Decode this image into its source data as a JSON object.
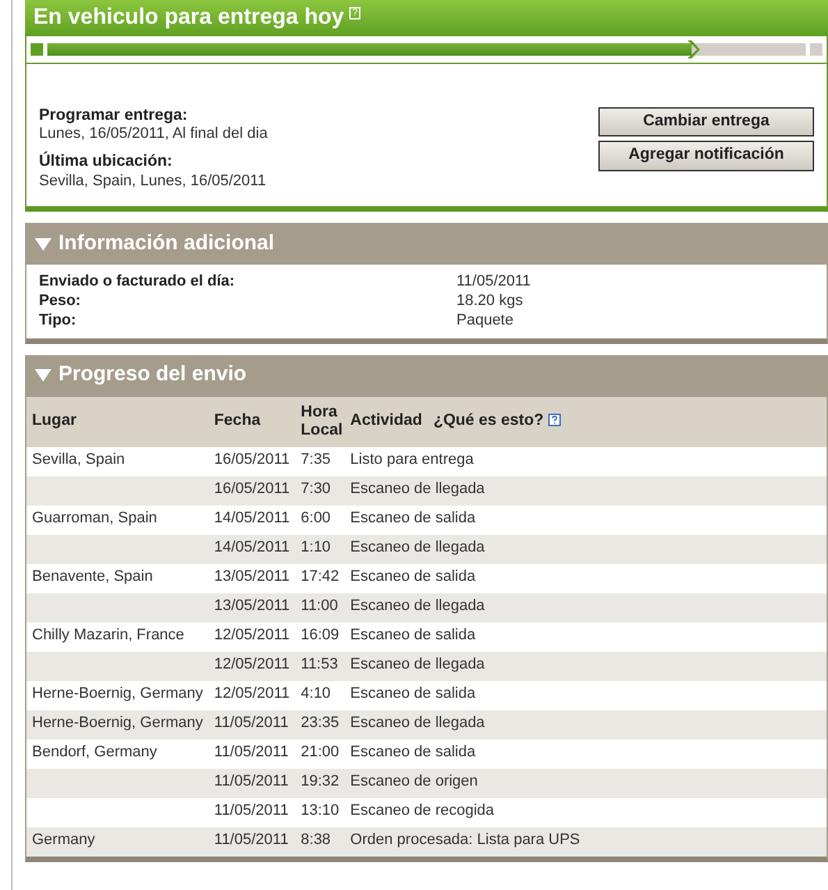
{
  "status": {
    "title": "En vehiculo para entrega hoy",
    "help_icon": "?",
    "progress": {
      "level": 0.85
    }
  },
  "delivery": {
    "fields": [
      {
        "label": "Programar entrega:",
        "value": "Lunes, 16/05/2011, Al final del dia"
      },
      {
        "label": "Última ubicación:",
        "value": "Sevilla, Spain, Lunes, 16/05/2011"
      }
    ],
    "buttons": [
      "Cambiar entrega",
      "Agregar notificación"
    ]
  },
  "additional_info": {
    "title": "Información adicional",
    "expanded": true,
    "rows": [
      {
        "label": "Enviado o facturado el día:",
        "value": "11/05/2011"
      },
      {
        "label": "Peso:",
        "value": "18.20 kgs"
      },
      {
        "label": "Tipo:",
        "value": "Paquete"
      }
    ]
  },
  "progress_table": {
    "title": "Progreso del envio",
    "expanded": true,
    "columns": [
      "Lugar",
      "Fecha",
      "Hora Local",
      "Actividad"
    ],
    "help_link": "¿Qué es esto?",
    "rows": [
      {
        "place": "Sevilla, Spain",
        "date": "16/05/2011",
        "time": "7:35",
        "activity": "Listo para entrega"
      },
      {
        "date": "16/05/2011",
        "time": "7:30",
        "activity": "Escaneo de llegada"
      },
      {
        "place": "Guarroman, Spain",
        "date": "14/05/2011",
        "time": "6:00",
        "activity": "Escaneo de salida"
      },
      {
        "date": "14/05/2011",
        "time": "1:10",
        "activity": "Escaneo de llegada"
      },
      {
        "place": "Benavente, Spain",
        "date": "13/05/2011",
        "time": "17:42",
        "activity": "Escaneo de salida"
      },
      {
        "date": "13/05/2011",
        "time": "11:00",
        "activity": "Escaneo de llegada"
      },
      {
        "place": "Chilly Mazarin, France",
        "date": "12/05/2011",
        "time": "16:09",
        "activity": "Escaneo de salida"
      },
      {
        "date": "12/05/2011",
        "time": "11:53",
        "activity": "Escaneo de llegada"
      },
      {
        "place": "Herne-Boernig, Germany",
        "date": "12/05/2011",
        "time": "4:10",
        "activity": "Escaneo de salida"
      },
      {
        "place": "Herne-Boernig, Germany",
        "date": "11/05/2011",
        "time": "23:35",
        "activity": "Escaneo de llegada"
      },
      {
        "place": "Bendorf, Germany",
        "date": "11/05/2011",
        "time": "21:00",
        "activity": "Escaneo de salida"
      },
      {
        "date": "11/05/2011",
        "time": "19:32",
        "activity": "Escaneo de origen"
      },
      {
        "date": "11/05/2011",
        "time": "13:10",
        "activity": "Escaneo de recogida"
      },
      {
        "place": "Germany",
        "date": "11/05/2011",
        "time": "8:38",
        "activity": "Orden procesada: Lista para UPS"
      }
    ]
  }
}
